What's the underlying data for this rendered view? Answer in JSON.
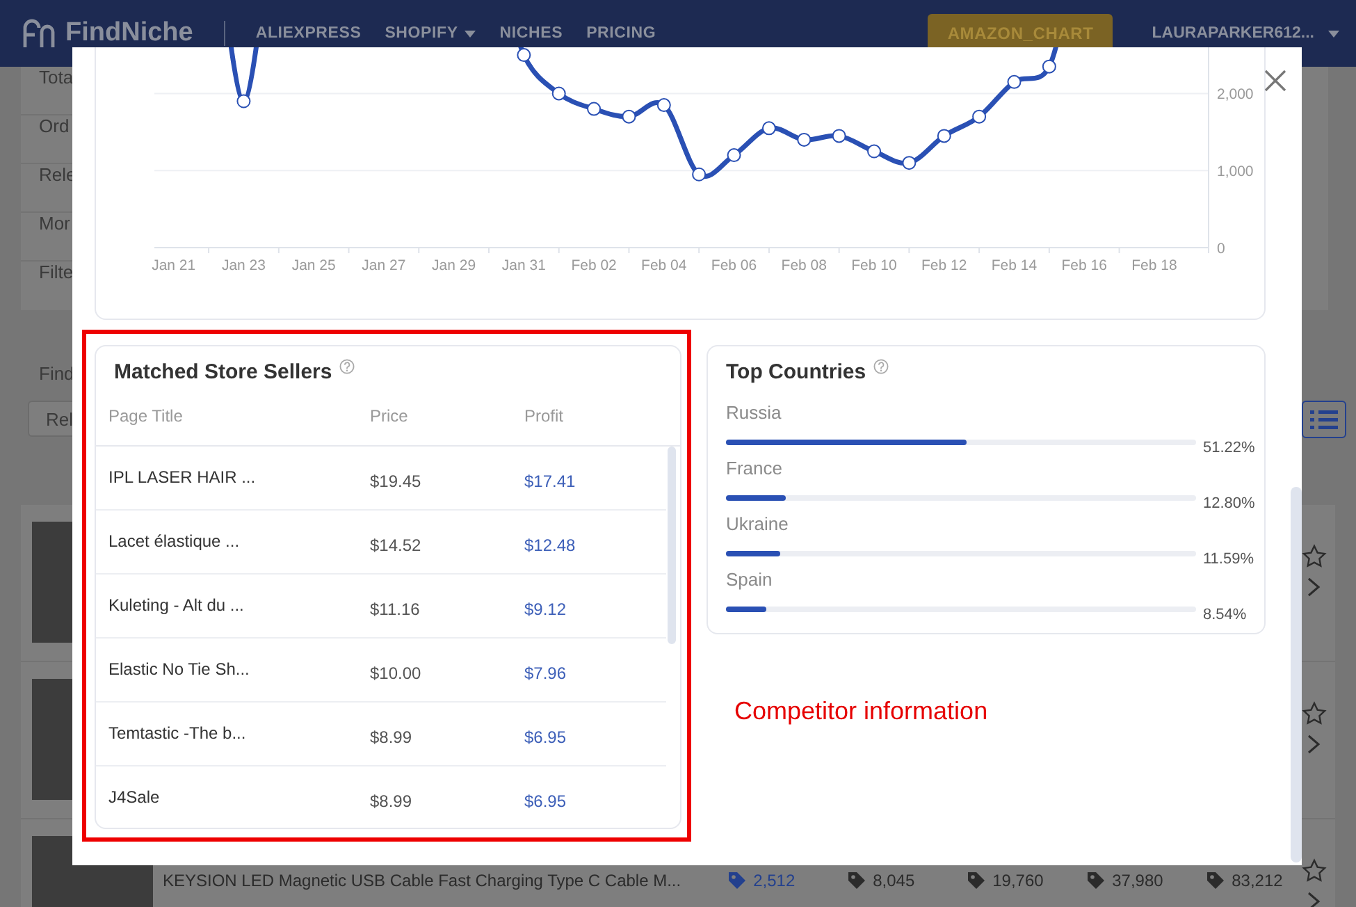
{
  "header": {
    "logo": "FindNiche",
    "nav": [
      {
        "label": "ALIEXPRESS",
        "dropdown": false
      },
      {
        "label": "SHOPIFY",
        "dropdown": true
      },
      {
        "label": "NICHES",
        "dropdown": false
      },
      {
        "label": "PRICING",
        "dropdown": false
      }
    ],
    "amazon_button": "AMAZON_CHART",
    "user": "LAURAPARKER612..."
  },
  "background": {
    "filters": [
      "Tota",
      "Ord",
      "Rele",
      "Mor",
      "Filte"
    ],
    "find_label": "Find",
    "sort_button": "Rel",
    "products": [
      {
        "starred": false
      },
      {
        "starred": false
      },
      {
        "starred": false,
        "title": "KEYSION LED Magnetic USB Cable Fast Charging Type C Cable M...",
        "stats": [
          {
            "value": "2,512",
            "highlighted": true
          },
          {
            "value": "8,045",
            "highlighted": false
          },
          {
            "value": "19,760",
            "highlighted": false
          },
          {
            "value": "37,980",
            "highlighted": false
          },
          {
            "value": "83,212",
            "highlighted": false
          }
        ]
      }
    ]
  },
  "modal": {
    "chart": {
      "chart_data": {
        "type": "line",
        "categories": [
          "Jan 21",
          null,
          "Jan 23",
          null,
          "Jan 25",
          null,
          "Jan 27",
          null,
          "Jan 29",
          null,
          "Jan 31",
          null,
          "Feb 02",
          null,
          "Feb 04",
          null,
          "Feb 06",
          null,
          "Feb 08",
          null,
          "Feb 10",
          null,
          "Feb 12",
          null,
          "Feb 14",
          null,
          "Feb 16",
          null,
          "Feb 18"
        ],
        "ylim": [
          0,
          2600
        ],
        "yticks": [
          {
            "value": 0,
            "label": "0"
          },
          {
            "value": 1000,
            "label": "1,000"
          },
          {
            "value": 2000,
            "label": "2,000"
          }
        ],
        "series": [
          {
            "color": "#2a50b4",
            "marker": true,
            "values": [
              null,
              null,
              1900,
              null,
              null,
              null,
              null,
              null,
              null,
              null,
              2500,
              2000,
              1800,
              1700,
              1850,
              950,
              1200,
              1550,
              1400,
              1450,
              1250,
              1100,
              1450,
              1700,
              2150,
              2350,
              null,
              null,
              null
            ]
          }
        ]
      }
    },
    "sellers": {
      "title": "Matched Store Sellers",
      "columns": [
        "Page Title",
        "Price",
        "Profit"
      ],
      "rows": [
        {
          "title": "IPL LASER HAIR ...",
          "price": "$19.45",
          "profit": "$17.41"
        },
        {
          "title": "Lacet élastique ...",
          "price": "$14.52",
          "profit": "$12.48"
        },
        {
          "title": "Kuleting - Alt du ...",
          "price": "$11.16",
          "profit": "$9.12"
        },
        {
          "title": "Elastic No Tie Sh...",
          "price": "$10.00",
          "profit": "$7.96"
        },
        {
          "title": "Temtastic -The b...",
          "price": "$8.99",
          "profit": "$6.95"
        },
        {
          "title": "J4Sale",
          "price": "$8.99",
          "profit": "$6.95"
        }
      ]
    },
    "countries": {
      "title": "Top Countries",
      "items": [
        {
          "name": "Russia",
          "level": 0.5122,
          "reading": "51.22%"
        },
        {
          "name": "France",
          "level": 0.128,
          "reading": "12.80%"
        },
        {
          "name": "Ukraine",
          "level": 0.1159,
          "reading": "11.59%"
        },
        {
          "name": "Spain",
          "level": 0.0854,
          "reading": "8.54%"
        }
      ]
    }
  },
  "annotation": {
    "text": "Competitor information"
  }
}
